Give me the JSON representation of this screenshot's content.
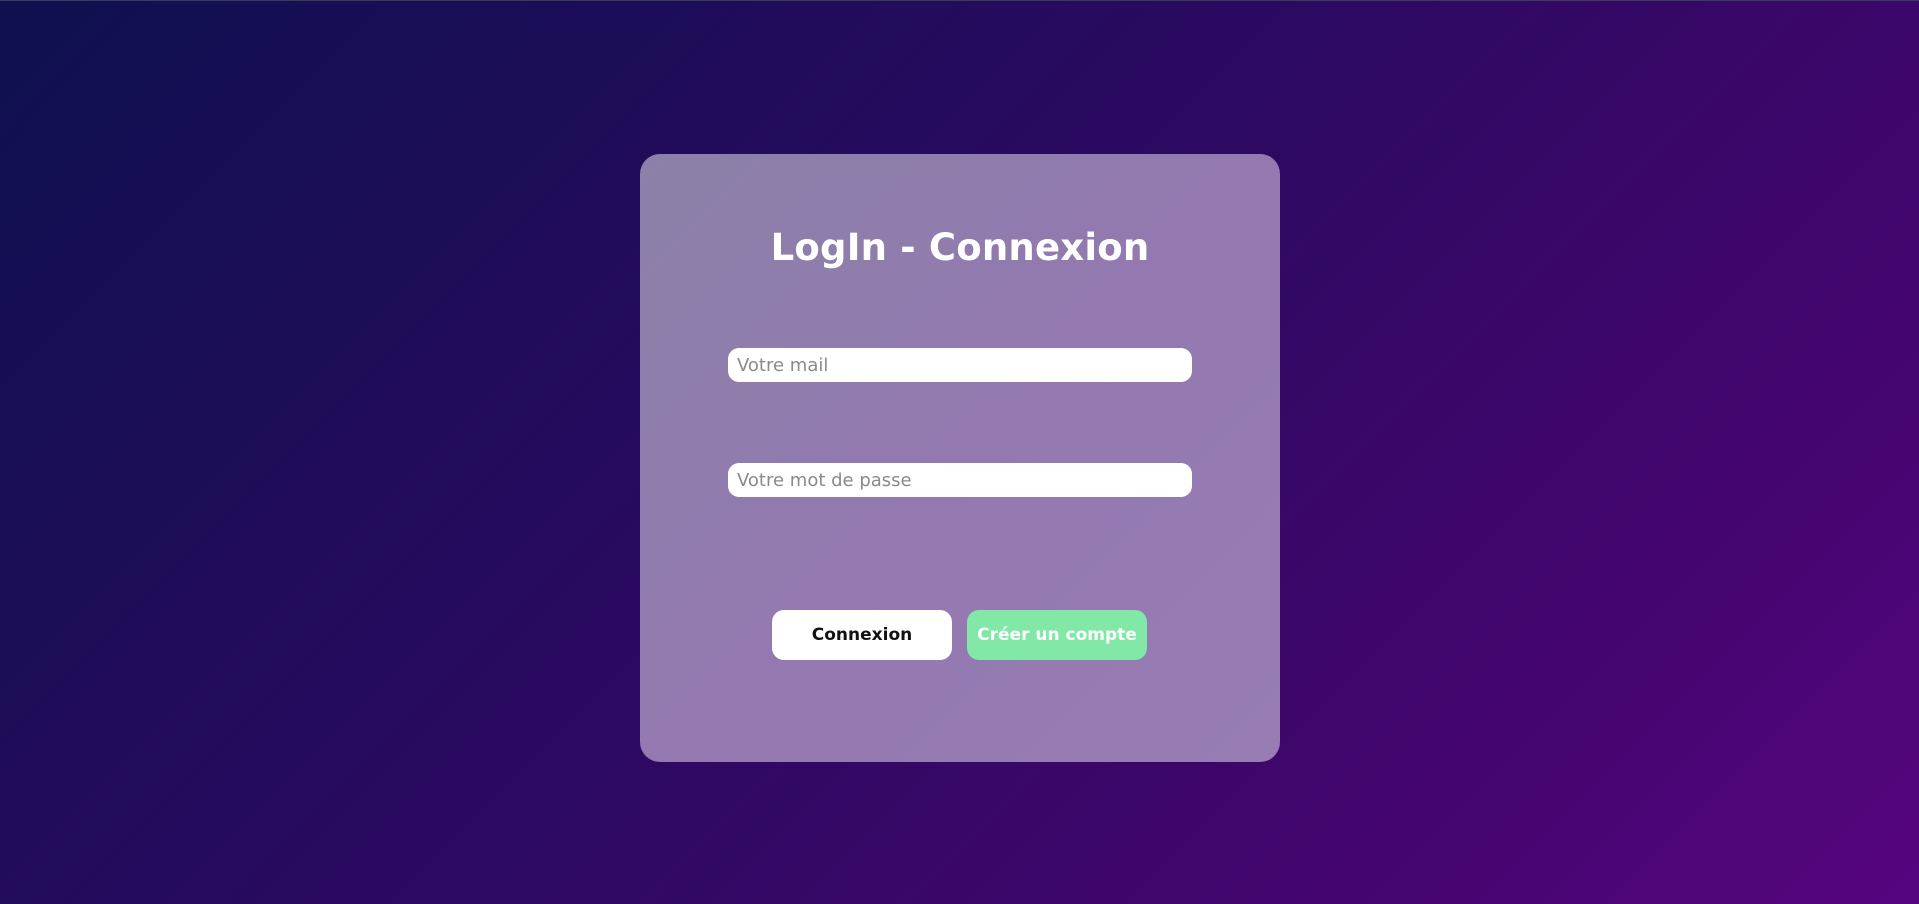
{
  "login_card": {
    "title": "LogIn - Connexion",
    "email_field": {
      "value": "",
      "placeholder": "Votre mail"
    },
    "password_field": {
      "value": "",
      "placeholder": "Votre mot de passe"
    },
    "login_button_label": "Connexion",
    "create_account_button_label": "Créer un compte"
  },
  "colors": {
    "background_start": "#0e1050",
    "background_end": "#560580",
    "card": "#9380b0",
    "create_account_button": "#82e8a8",
    "login_button": "#ffffff"
  }
}
